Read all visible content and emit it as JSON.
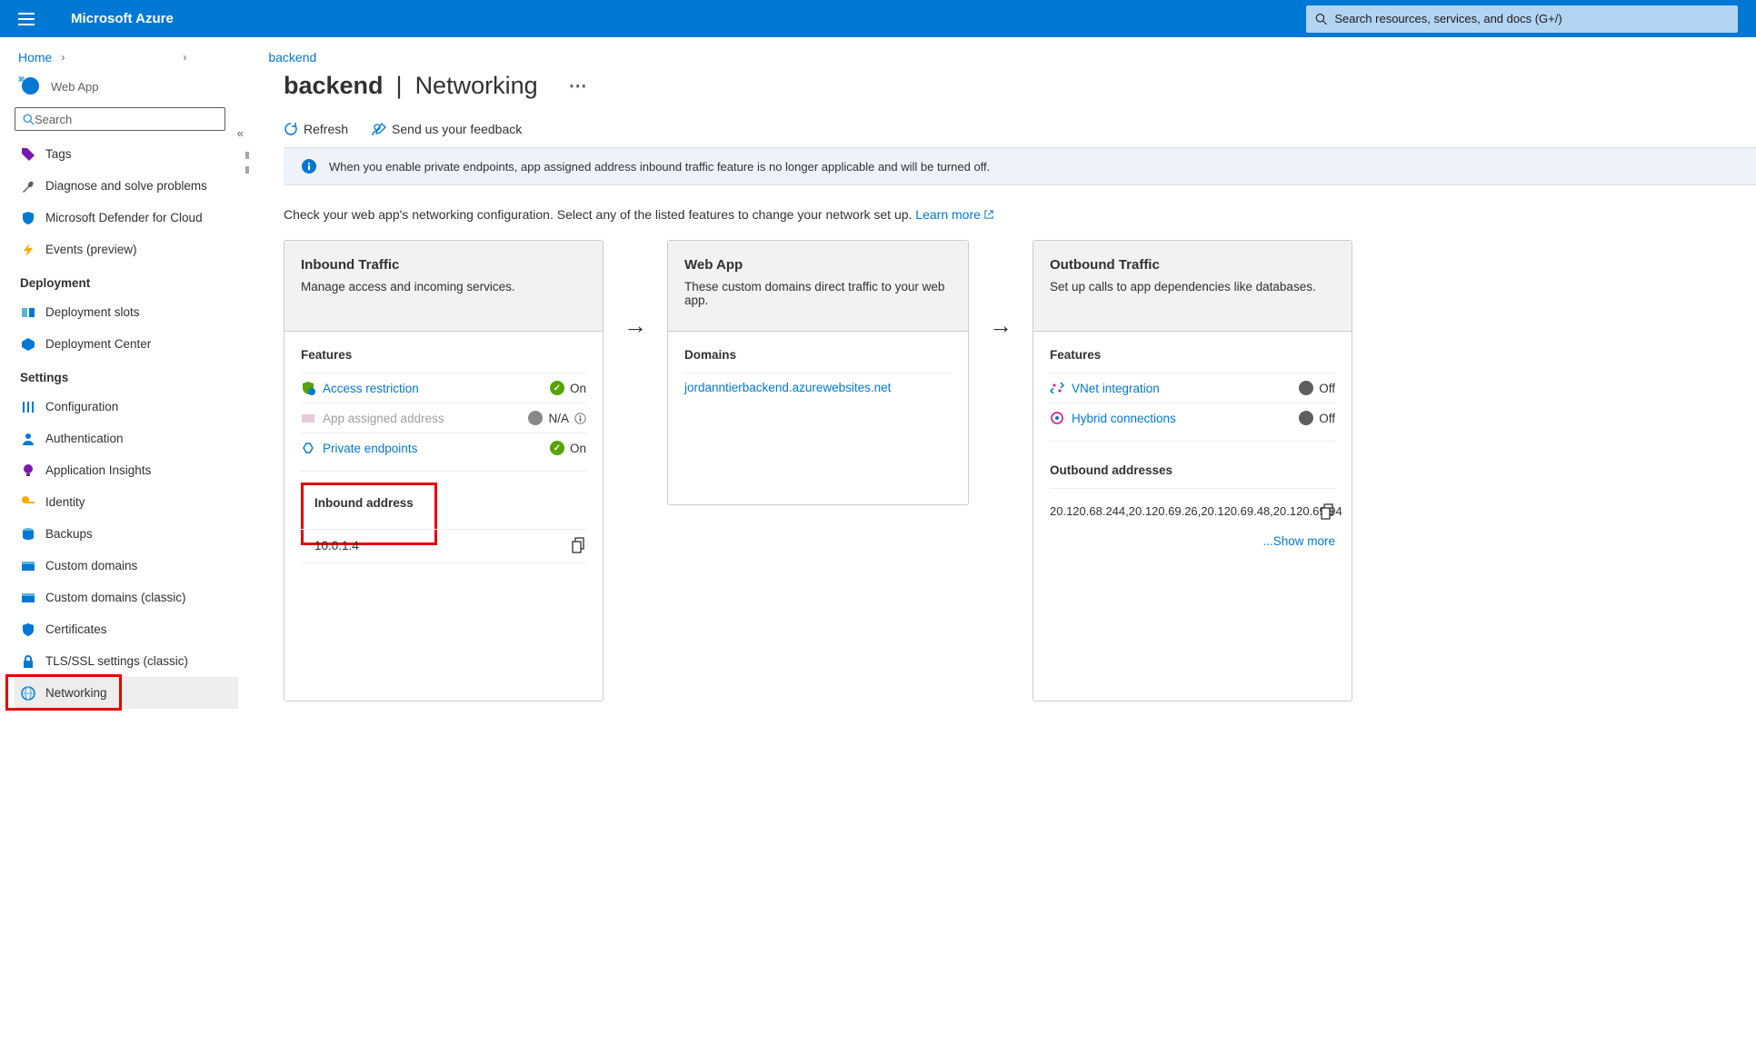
{
  "header": {
    "brand": "Microsoft Azure",
    "search_placeholder": "Search resources, services, and docs (G+/)"
  },
  "breadcrumbs": {
    "home": "Home",
    "current": "backend"
  },
  "sidebar": {
    "subtitle": "Web App",
    "search_placeholder": "Search",
    "items": [
      {
        "label": "Tags"
      },
      {
        "label": "Diagnose and solve problems"
      },
      {
        "label": "Microsoft Defender for Cloud"
      },
      {
        "label": "Events (preview)"
      }
    ],
    "deployment_header": "Deployment",
    "deployment": [
      {
        "label": "Deployment slots"
      },
      {
        "label": "Deployment Center"
      }
    ],
    "settings_header": "Settings",
    "settings": [
      {
        "label": "Configuration"
      },
      {
        "label": "Authentication"
      },
      {
        "label": "Application Insights"
      },
      {
        "label": "Identity"
      },
      {
        "label": "Backups"
      },
      {
        "label": "Custom domains"
      },
      {
        "label": "Custom domains (classic)"
      },
      {
        "label": "Certificates"
      },
      {
        "label": "TLS/SSL settings (classic)"
      },
      {
        "label": "Networking"
      }
    ]
  },
  "page": {
    "title_left": "backend",
    "title_right": "Networking"
  },
  "toolbar": {
    "refresh": "Refresh",
    "feedback": "Send us your feedback"
  },
  "notice": "When you enable private endpoints, app assigned address inbound traffic feature is no longer applicable and will be turned off.",
  "intro": {
    "text": "Check your web app's networking configuration. Select any of the listed features to change your network set up. ",
    "link": "Learn more"
  },
  "inbound": {
    "title": "Inbound Traffic",
    "desc": "Manage access and incoming services.",
    "features_label": "Features",
    "rows": [
      {
        "label": "Access restriction",
        "status": "On",
        "state": "green",
        "link": true
      },
      {
        "label": "App assigned address",
        "status": "N/A",
        "state": "grey",
        "link": false,
        "info": true
      },
      {
        "label": "Private endpoints",
        "status": "On",
        "state": "green",
        "link": true
      }
    ],
    "address_label": "Inbound address",
    "address_value": "10.0.1.4"
  },
  "webapp": {
    "title": "Web App",
    "desc": "These custom domains direct traffic to your web app.",
    "domains_label": "Domains",
    "domain": "jordanntierbackend.azurewebsites.net"
  },
  "outbound": {
    "title": "Outbound Traffic",
    "desc": "Set up calls to app dependencies like databases.",
    "features_label": "Features",
    "rows": [
      {
        "label": "VNet integration",
        "status": "Off"
      },
      {
        "label": "Hybrid connections",
        "status": "Off"
      }
    ],
    "addresses_label": "Outbound addresses",
    "addresses": "20.120.68.244,20.120.69.26,20.120.69.48,20.120.69.94",
    "show_more": "...Show more"
  }
}
